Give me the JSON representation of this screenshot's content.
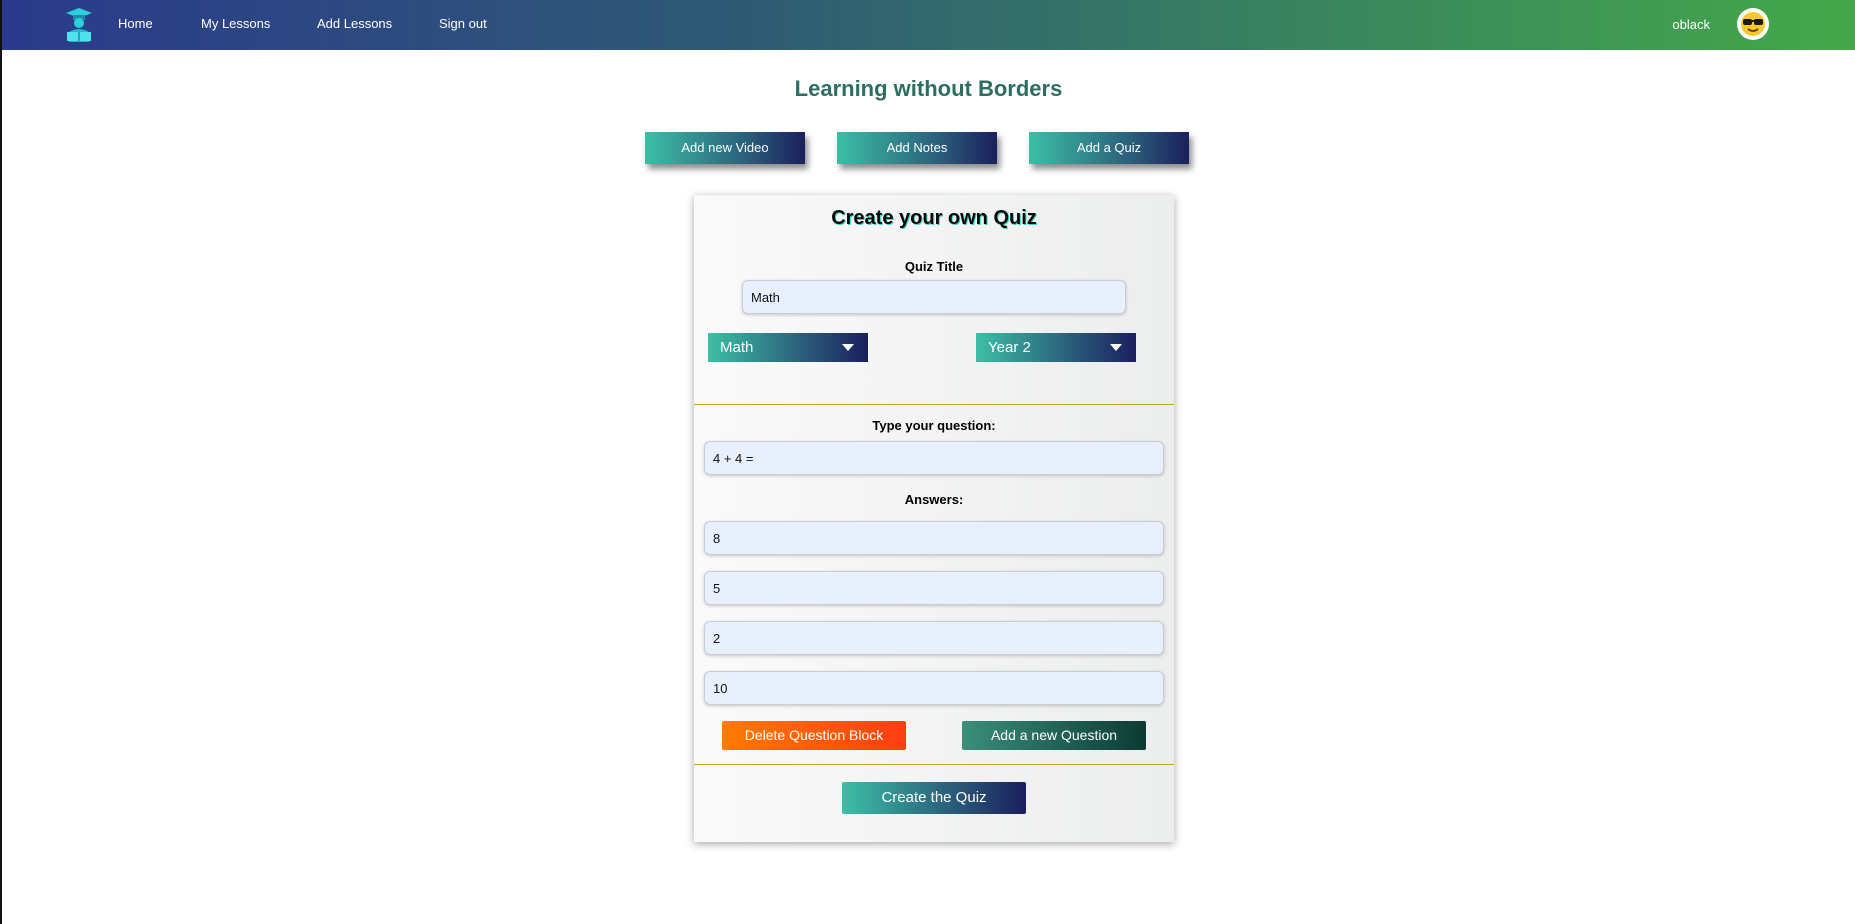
{
  "nav": {
    "links": [
      "Home",
      "My Lessons",
      "Add Lessons",
      "Sign out"
    ],
    "username": "oblack"
  },
  "site_title": "Learning without Borders",
  "top_buttons": [
    "Add new Video",
    "Add Notes",
    "Add a Quiz"
  ],
  "quiz": {
    "heading": "Create your own Quiz",
    "title_label": "Quiz Title",
    "title_value": "Math",
    "subject": "Math",
    "year": "Year 2",
    "question_label": "Type your question:",
    "question_value": "4 + 4 =",
    "answers_label": "Answers:",
    "answers": [
      "8",
      "5",
      "2",
      "10"
    ],
    "delete_block_label": "Delete Question Block",
    "add_question_label": "Add a new Question",
    "create_label": "Create the Quiz"
  },
  "colors": {
    "accent_teal": "#3cbfa5",
    "accent_navy": "#1b1f5e",
    "delete_orange": "#ff7a00",
    "delete_red": "#ff3d12",
    "title_green": "#2d6e62"
  }
}
